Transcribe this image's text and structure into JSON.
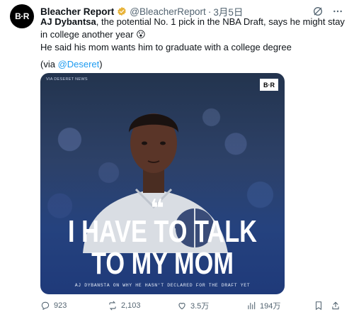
{
  "author": {
    "avatar_text": "B·R",
    "name": "Bleacher Report",
    "handle": "@BleacherReport",
    "separator": "·",
    "date": "3月5日"
  },
  "tweet": {
    "line1_bold": "AJ Dybantsa",
    "line1_rest": ", the potential No. 1 pick in the NBA Draft, says he might stay in college another year 😮",
    "line2": "He said his mom wants him to graduate with a college degree",
    "line3_prefix": "(via ",
    "line3_link": "@Deseret",
    "line3_suffix": ")"
  },
  "media": {
    "watermark_small": "VIA DESERET NEWS",
    "logo": "B·R",
    "quote": "❝",
    "headline_line1": "I HAVE TO TALK",
    "headline_line2": "TO MY MOM",
    "subtext": "AJ DYBANSTA ON WHY HE HASN'T DECLARED FOR THE DRAFT YET"
  },
  "actions": {
    "replies": "923",
    "reposts": "2,103",
    "likes": "3.5万",
    "views": "194万"
  },
  "colors": {
    "link": "#1d9bf0",
    "secondary_text": "#536471",
    "verified": "#e8b339"
  }
}
